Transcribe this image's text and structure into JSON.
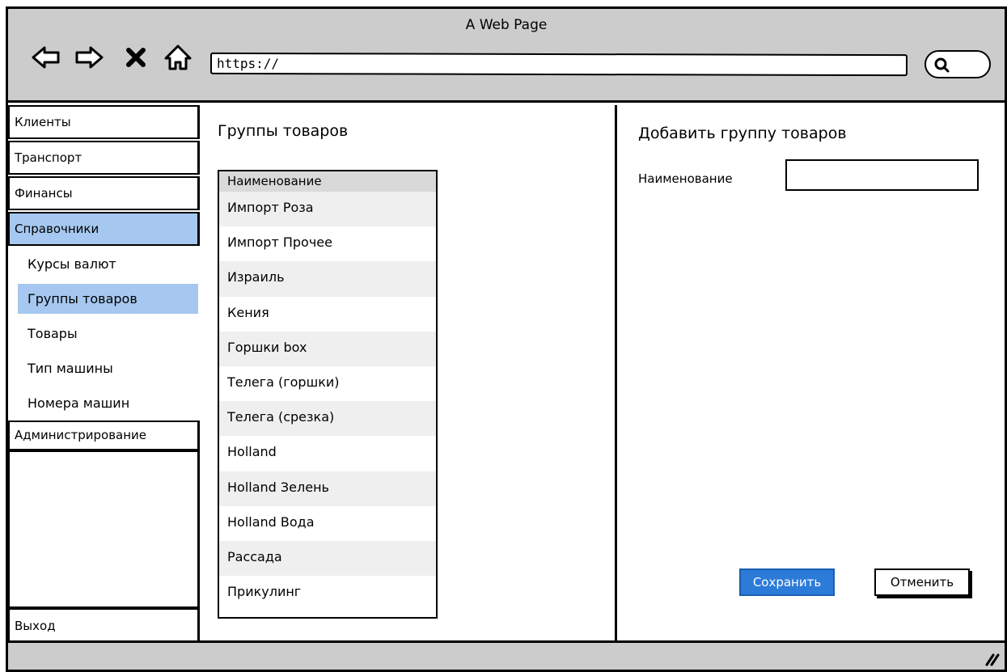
{
  "window": {
    "title": "A Web Page",
    "url": "https://"
  },
  "icons": {
    "back": "arrow-left-icon",
    "forward": "arrow-right-icon",
    "stop": "close-icon",
    "home": "home-icon",
    "search": "search-icon",
    "resize": "resize-grip-icon"
  },
  "sidebar": {
    "items": [
      {
        "label": "Клиенты"
      },
      {
        "label": "Транспорт"
      },
      {
        "label": "Финансы"
      },
      {
        "label": "Справочники",
        "active": true
      }
    ],
    "subitems": [
      {
        "label": "Курсы валют"
      },
      {
        "label": "Группы товаров",
        "active": true
      },
      {
        "label": "Товары"
      },
      {
        "label": "Тип машины"
      },
      {
        "label": "Номера машин"
      }
    ],
    "admin_label": "Администрирование",
    "logout_label": "Выход"
  },
  "groups": {
    "title": "Группы товаров",
    "column_header": "Наименование",
    "rows": [
      "Импорт Роза",
      "Импорт Прочее",
      "Израиль",
      "Кения",
      "Горшки box",
      "Телега (горшки)",
      "Телега (срезка)",
      "Holland",
      "Holland Зелень",
      "Holland Вода",
      "Рассада",
      "Прикулинг"
    ]
  },
  "form": {
    "title": "Добавить группу товаров",
    "name_label": "Наименование",
    "name_value": "",
    "save_label": "Сохранить",
    "cancel_label": "Отменить"
  },
  "colors": {
    "selected": "#a6c8f0",
    "primary_button": "#2c7bd9",
    "chrome": "#cccccc"
  }
}
